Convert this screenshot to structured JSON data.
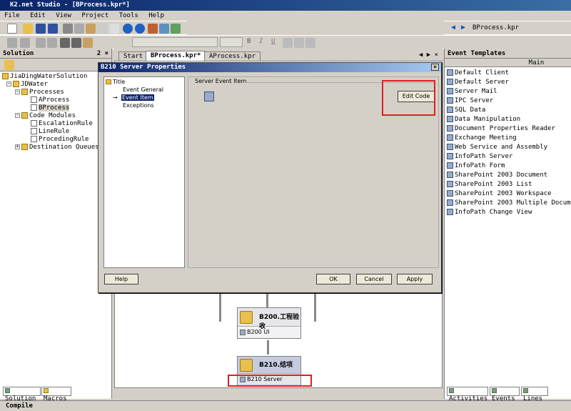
{
  "app": {
    "title": "K2.net Studio - [BProcess.kpr*]"
  },
  "menu": [
    "File",
    "Edit",
    "View",
    "Project",
    "Tools",
    "Help"
  ],
  "toolbar": {
    "nav_file": "BProcess.kpr",
    "style_b": "B",
    "style_i": "I",
    "style_u": "U"
  },
  "solution": {
    "title": "Solution",
    "pin": "2 ×",
    "tree": [
      "JiaDingWaterSolution",
      "JDWater",
      "Processes",
      "AProcess",
      "BProcess",
      "Code Modules",
      "EscalationRule",
      "LineRule",
      "ProcedingRule",
      "Destination Queues"
    ],
    "tabs": [
      "Solution",
      "Macros"
    ]
  },
  "doc_tabs": [
    "Start",
    "BProcess.kpr*",
    "AProcess.kpr"
  ],
  "dialog": {
    "title": "B210 Server Properties",
    "tree": [
      "Title",
      "Event General",
      "Event Item",
      "Exceptions"
    ],
    "section_label": "Server Event Item",
    "edit_code": "Edit Code",
    "help": "Help",
    "ok": "OK",
    "cancel": "Cancel",
    "apply": "Apply"
  },
  "canvas": {
    "b200_title": "B200.工程验收",
    "b200_item": "B200 UI",
    "b210_title": "B210.结项",
    "b210_item": "B210 Server"
  },
  "events": {
    "title": "Event Templates",
    "column": "Main",
    "items": [
      "Default Client",
      "Default Server",
      "Server Mail",
      "IPC Server",
      "SQL Data",
      "Data Manipulation",
      "Document Properties Reader",
      "Exchange Meeting",
      "Web Service and Assembly",
      "InfoPath Server",
      "InfoPath Form",
      "SharePoint 2003 Document",
      "SharePoint 2003 List",
      "SharePoint 2003 Workspace",
      "SharePoint 2003 Multiple Documents",
      "InfoPath Change View"
    ],
    "tabs": [
      "Activities",
      "Events",
      "Lines"
    ]
  },
  "status": {
    "compile": "Compile"
  }
}
